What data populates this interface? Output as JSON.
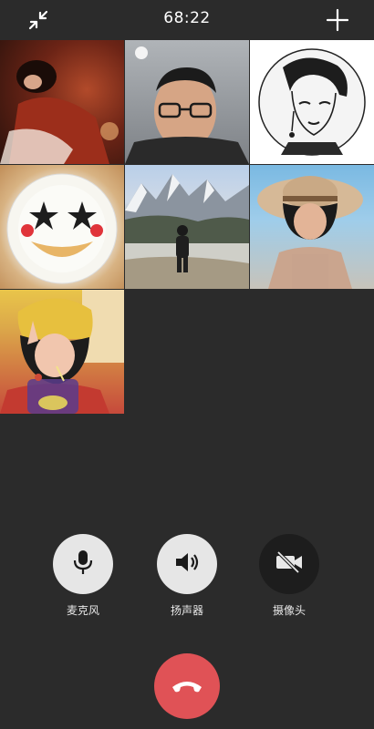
{
  "call": {
    "duration": "68:22"
  },
  "topbar": {
    "minimize_icon": "minimize-arrows-icon",
    "add_icon": "plus-icon"
  },
  "participants": [
    {
      "id": "p1",
      "image": "woman-red-sweater-photo"
    },
    {
      "id": "p2",
      "image": "man-with-glasses-video"
    },
    {
      "id": "p3",
      "image": "line-art-portrait-avatar"
    },
    {
      "id": "p4",
      "image": "smiley-plate-photo"
    },
    {
      "id": "p5",
      "image": "person-in-snowy-mountains-photo"
    },
    {
      "id": "p6",
      "image": "woman-straw-hat-photo"
    },
    {
      "id": "p7",
      "image": "girl-peace-sign-photo"
    }
  ],
  "controls": {
    "mic": {
      "label": "麦克风",
      "icon": "microphone-icon",
      "state": "on"
    },
    "speaker": {
      "label": "扬声器",
      "icon": "speaker-icon",
      "state": "on"
    },
    "camera": {
      "label": "摄像头",
      "icon": "camera-off-icon",
      "state": "off"
    }
  },
  "hangup": {
    "icon": "phone-hangup-icon"
  },
  "colors": {
    "background": "#2b2b2b",
    "control_on": "#e6e6e6",
    "control_off": "#1d1d1d",
    "hangup": "#e05256"
  }
}
